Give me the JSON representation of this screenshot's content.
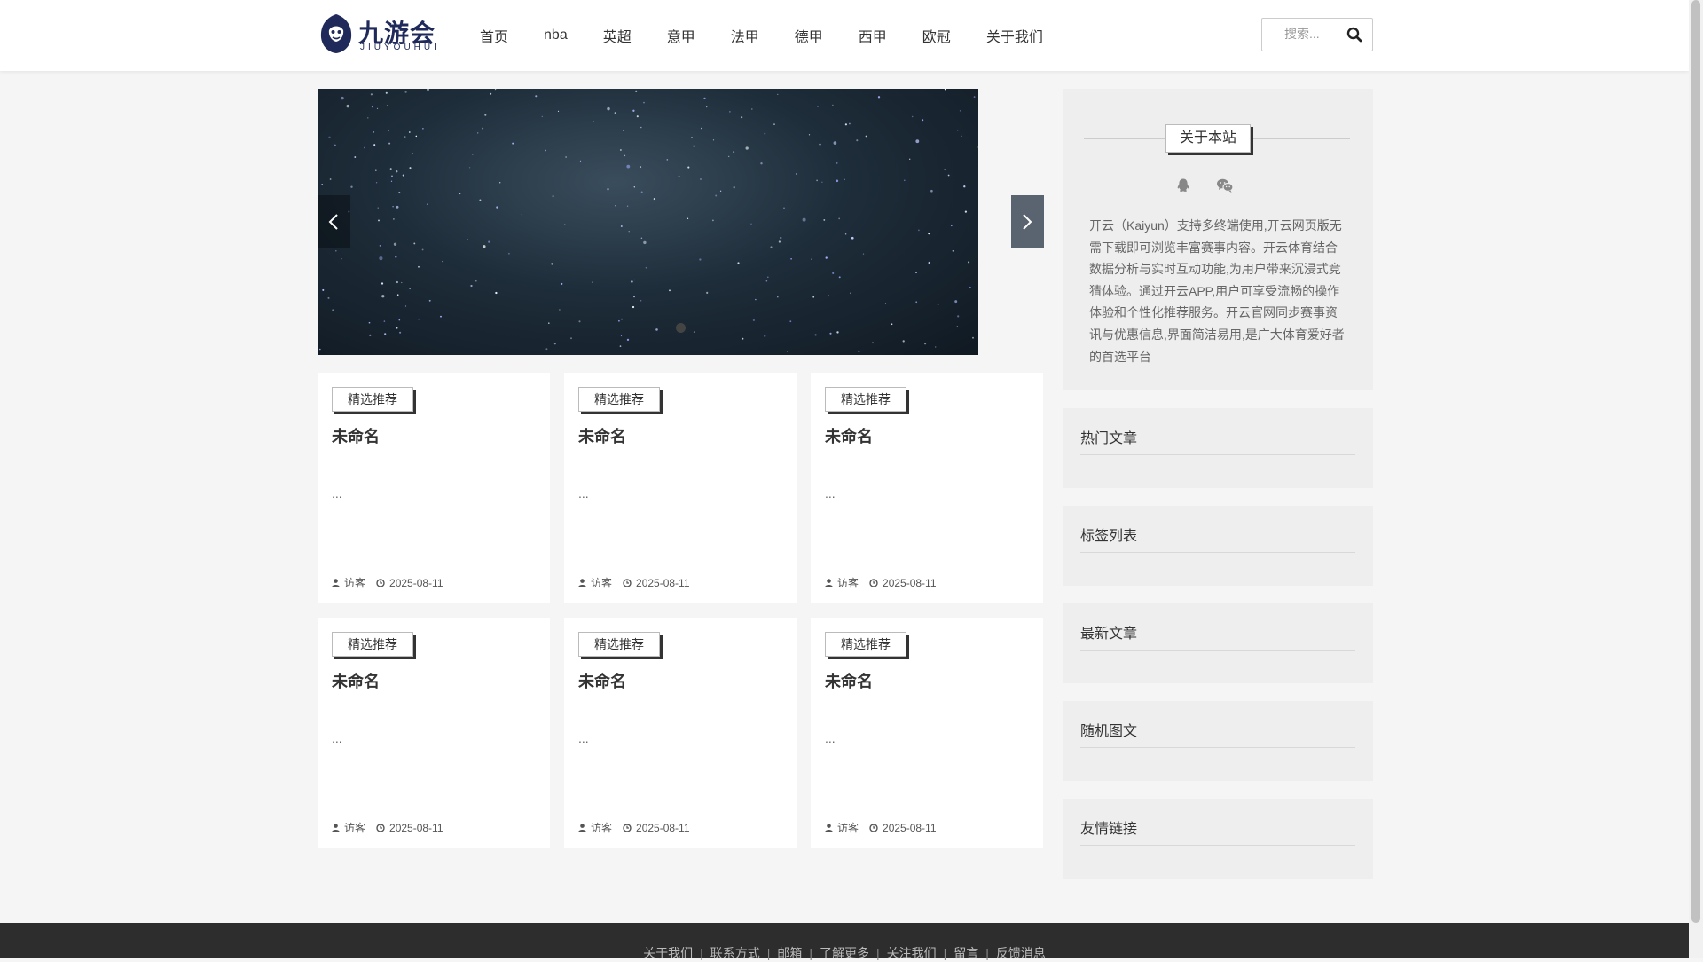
{
  "header": {
    "logo_text": "九游会",
    "logo_sub": "JIUYOUHUI",
    "nav": [
      "首页",
      "nba",
      "英超",
      "意甲",
      "法甲",
      "德甲",
      "西甲",
      "欧冠",
      "关于我们"
    ],
    "search_placeholder": "搜索..."
  },
  "slider": {
    "dots": 1
  },
  "cards": [
    {
      "tag": "精选推荐",
      "title": "未命名",
      "excerpt": "...",
      "author": "访客",
      "date": "2025-08-11"
    },
    {
      "tag": "精选推荐",
      "title": "未命名",
      "excerpt": "...",
      "author": "访客",
      "date": "2025-08-11"
    },
    {
      "tag": "精选推荐",
      "title": "未命名",
      "excerpt": "...",
      "author": "访客",
      "date": "2025-08-11"
    },
    {
      "tag": "精选推荐",
      "title": "未命名",
      "excerpt": "...",
      "author": "访客",
      "date": "2025-08-11"
    },
    {
      "tag": "精选推荐",
      "title": "未命名",
      "excerpt": "...",
      "author": "访客",
      "date": "2025-08-11"
    },
    {
      "tag": "精选推荐",
      "title": "未命名",
      "excerpt": "...",
      "author": "访客",
      "date": "2025-08-11"
    }
  ],
  "sidebar": {
    "about_title": "关于本站",
    "about_icons": [
      "qq-icon",
      "wechat-icon"
    ],
    "about_text": "开云（Kaiyun）支持多终端使用,开云网页版无需下载即可浏览丰富赛事内容。开云体育结合数据分析与实时互动功能,为用户带来沉浸式竞猜体验。通过开云APP,用户可享受流畅的操作体验和个性化推荐服务。开云官网同步赛事资讯与优惠信息,界面简洁易用,是广大体育爱好者的首选平台",
    "widgets": [
      "热门文章",
      "标签列表",
      "最新文章",
      "随机图文",
      "友情链接"
    ]
  },
  "footer": {
    "links": [
      "关于我们",
      "联系方式",
      "邮箱",
      "了解更多",
      "关注我们",
      "留言",
      "反馈消息"
    ]
  },
  "colors": {
    "brand": "#1f2a5a",
    "page_bg": "#f5f5f5",
    "footer_bg": "#2d2d2d"
  }
}
